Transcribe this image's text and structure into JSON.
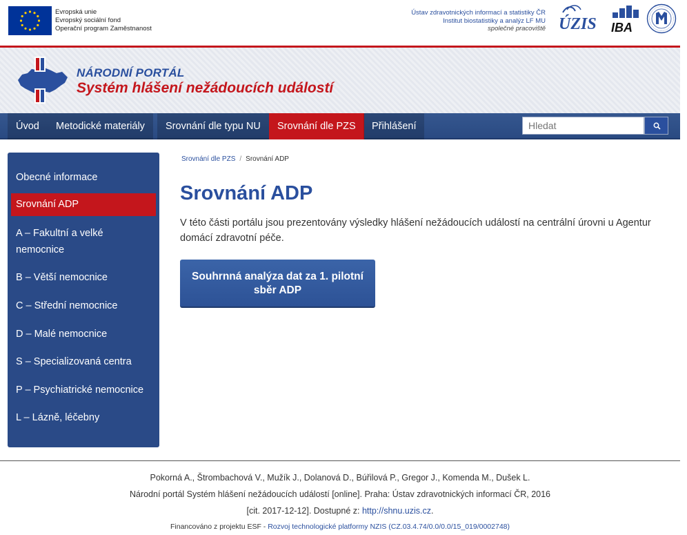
{
  "header": {
    "eu_lines": [
      "Evropská unie",
      "Evropský sociální fond",
      "Operační program Zaměstnanost"
    ],
    "institution_lines": [
      "Ústav zdravotnických informací a statistiky ČR",
      "Institut biostatistiky a analýz LF MU"
    ],
    "institution_note": "společné pracoviště",
    "uzis_logo_text": "ÚZIS",
    "iba_logo_text": "IBA"
  },
  "banner": {
    "subtitle": "NÁRODNÍ PORTÁL",
    "title": "Systém hlášení nežádoucích událostí"
  },
  "nav": {
    "items": [
      "Úvod",
      "Metodické materiály",
      "Srovnání dle typu NU",
      "Srovnání dle PZS",
      "Přihlášení"
    ],
    "active_index": 3,
    "search_placeholder": "Hledat"
  },
  "sidebar": {
    "items": [
      "Obecné informace",
      "Srovnání ADP",
      "A – Fakultní a velké nemocnice",
      "B – Větší nemocnice",
      "C – Střední nemocnice",
      "D – Malé nemocnice",
      "S – Specializovaná centra",
      "P – Psychiatrické nemocnice",
      "L – Lázně, léčebny"
    ],
    "active_index": 1
  },
  "breadcrumb": {
    "parent": "Srovnání dle PZS",
    "separator": "/",
    "current": "Srovnání ADP"
  },
  "main": {
    "title": "Srovnání ADP",
    "intro": "V této části portálu jsou prezentovány výsledky hlášení nežádoucích událostí na centrální úrovni u Agentur domácí zdravotní péče.",
    "button_label": "Souhrnná analýza dat za 1. pilotní sběr ADP"
  },
  "footer": {
    "authors": "Pokorná A., Štrombachová V., Mužík J., Dolanová D., Búřilová P., Gregor J., Komenda M., Dušek L.",
    "citation": "Národní portál Systém hlášení nežádoucích událostí [online]. Praha: Ústav zdravotnických informací ČR, 2016",
    "cit_prefix": "[cit. 2017-12-12]. Dostupné z: ",
    "cit_link": "http://shnu.uzis.cz",
    "cit_suffix": ".",
    "funding_prefix": "Financováno z projektu ESF - ",
    "funding_link": "Rozvoj technologické platformy NZIS (CZ.03.4.74/0.0/0.0/15_019/0002748)"
  },
  "colors": {
    "brand_blue": "#2a4f9e",
    "brand_red": "#c4161c",
    "nav_bg": "#2a4a82"
  }
}
